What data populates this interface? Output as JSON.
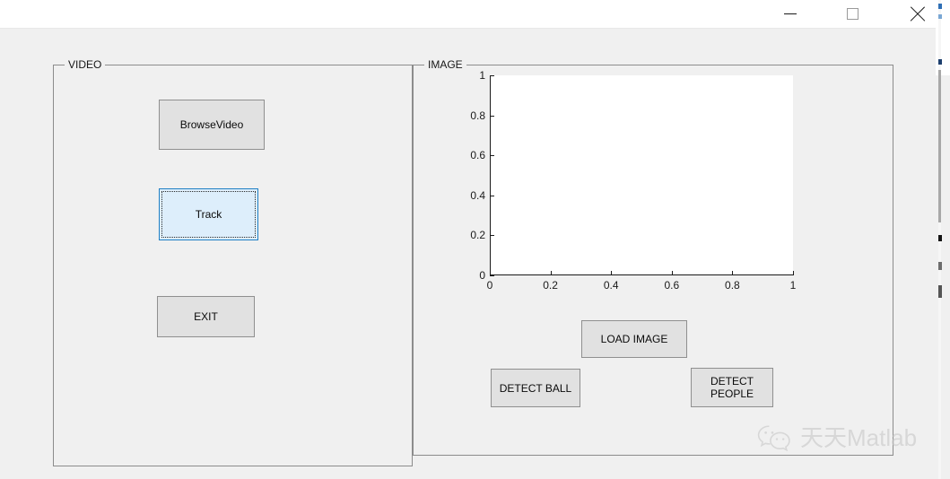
{
  "window": {
    "controls": [
      {
        "name": "minimize-button",
        "label": "—"
      },
      {
        "name": "maximize-button",
        "label": "□"
      },
      {
        "name": "close-button",
        "label": "✕"
      }
    ],
    "background_color": "#f0f0f0",
    "titlebar_color": "#ffffff"
  },
  "panels": {
    "video": {
      "title": "VIDEO",
      "buttons": {
        "browse_video": "BrowseVideo",
        "track": "Track",
        "exit": "EXIT"
      },
      "focused_button": "Track",
      "focus_fill_color": "#ddeefb",
      "focus_border_color": "#1f7fc4"
    },
    "image": {
      "title": "IMAGE",
      "buttons": {
        "load_image": "LOAD IMAGE",
        "detect_ball": "DETECT BALL",
        "detect_people": "DETECT PEOPLE"
      }
    }
  },
  "chart_data": {
    "type": "line",
    "title": "",
    "xlabel": "",
    "ylabel": "",
    "xlim": [
      0,
      1
    ],
    "ylim": [
      0,
      1
    ],
    "xticks": [
      0,
      0.2,
      0.4,
      0.6,
      0.8,
      1
    ],
    "yticks": [
      0,
      0.2,
      0.4,
      0.6,
      0.8,
      1
    ],
    "xticklabels": [
      "0",
      "0.2",
      "0.4",
      "0.6",
      "0.8",
      "1"
    ],
    "yticklabels": [
      "0",
      "0.2",
      "0.4",
      "0.6",
      "0.8",
      "1"
    ],
    "series": [],
    "grid": false,
    "legend": false,
    "plot_background": "#ffffff",
    "axis_color": "#1a1a1a"
  },
  "watermark": {
    "icon": "wechat-icon",
    "text": "天天Matlab",
    "color": "#c9c9c9"
  }
}
